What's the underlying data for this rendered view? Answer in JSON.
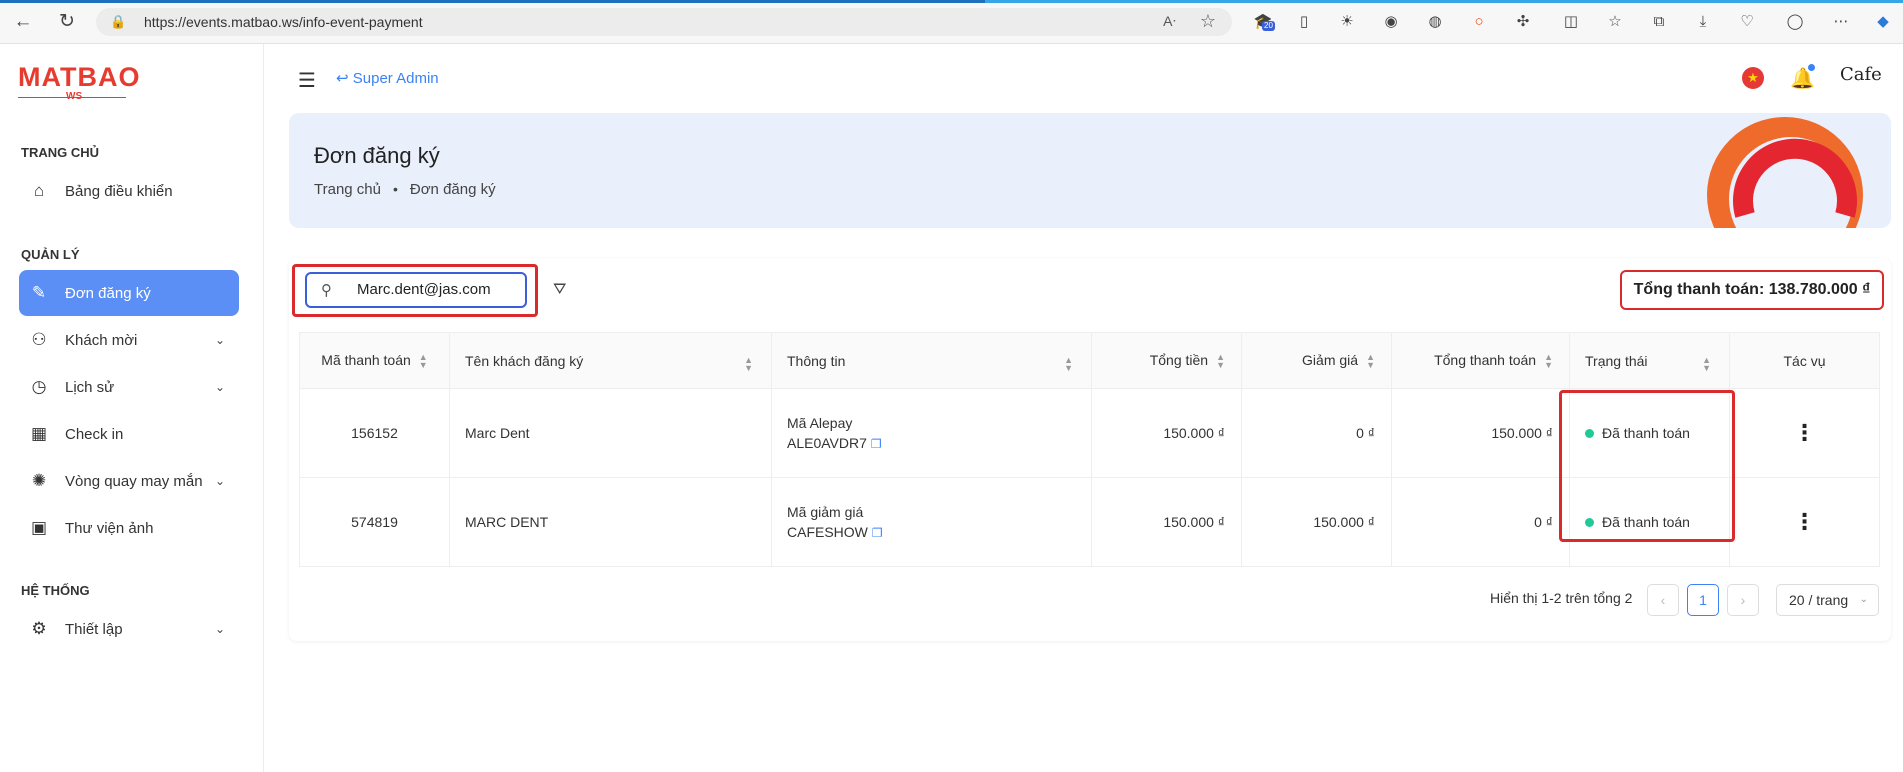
{
  "browser": {
    "url": "https://events.matbao.ws/info-event-payment",
    "badge_count": "20"
  },
  "brand": {
    "logo": "MATBAO",
    "logo_sub": "WS"
  },
  "sidebar": {
    "sections": [
      {
        "title": "TRANG CHỦ"
      },
      {
        "title": "QUẢN LÝ"
      },
      {
        "title": "HỆ THỐNG"
      }
    ],
    "items": [
      {
        "label": "Bảng điều khiển",
        "icon": "home-icon"
      },
      {
        "label": "Đơn đăng ký",
        "icon": "document-edit-icon",
        "active": true
      },
      {
        "label": "Khách mời",
        "icon": "users-icon",
        "has_children": true
      },
      {
        "label": "Lịch sử",
        "icon": "clock-icon",
        "has_children": true
      },
      {
        "label": "Check in",
        "icon": "calendar-icon"
      },
      {
        "label": "Vòng quay may mắn",
        "icon": "wheel-icon",
        "has_children": true
      },
      {
        "label": "Thư viện ảnh",
        "icon": "image-icon"
      },
      {
        "label": "Thiết lập",
        "icon": "gear-icon",
        "has_children": true
      }
    ]
  },
  "header": {
    "role_link": "Super Admin",
    "avatar_text": "Cafe"
  },
  "hero": {
    "title": "Đơn đăng ký",
    "breadcrumb": [
      "Trang chủ",
      "Đơn đăng ký"
    ]
  },
  "toolbar": {
    "search_value": "Marc.dent@jas.com",
    "total_label": "Tổng thanh toán: 138.780.000 ₫"
  },
  "table": {
    "columns": [
      "Mã thanh toán",
      "Tên khách đăng ký",
      "Thông tin",
      "Tổng tiền",
      "Giảm giá",
      "Tổng thanh toán",
      "Trạng thái",
      "Tác vụ"
    ],
    "rows": [
      {
        "code": "156152",
        "name": "Marc Dent",
        "info_label": "Mã Alepay",
        "info_value": "ALE0AVDR7",
        "amount": "150.000 ₫",
        "discount": "0 ₫",
        "total": "150.000 ₫",
        "status": "Đã thanh toán"
      },
      {
        "code": "574819",
        "name": "MARC DENT",
        "info_label": "Mã giảm giá",
        "info_value": "CAFESHOW",
        "amount": "150.000 ₫",
        "discount": "150.000 ₫",
        "total": "0 ₫",
        "status": "Đã thanh toán"
      }
    ]
  },
  "pagination": {
    "summary": "Hiển thị 1-2 trên tổng 2",
    "current_page": "1",
    "page_size": "20 / trang"
  },
  "colors": {
    "accent": "#5b8ff5",
    "brand_red": "#e63b2e",
    "status_green": "#20c997",
    "highlight_red": "#d92b2b"
  }
}
